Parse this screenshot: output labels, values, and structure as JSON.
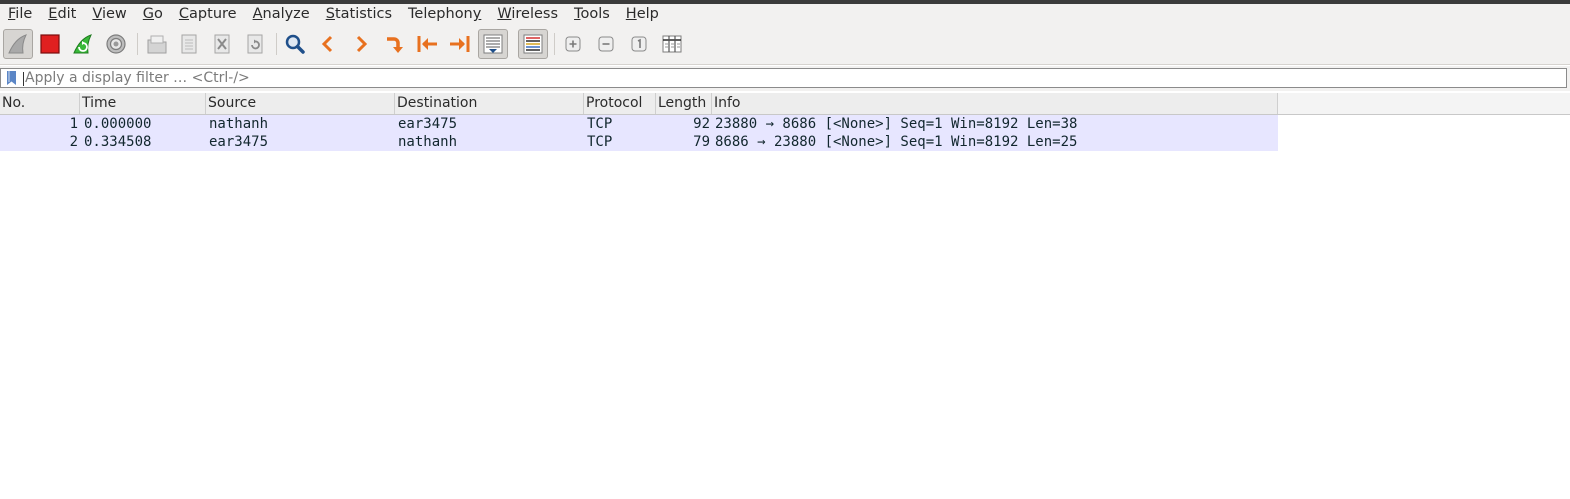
{
  "menu": [
    {
      "pre": "",
      "mn": "F",
      "post": "ile"
    },
    {
      "pre": "",
      "mn": "E",
      "post": "dit"
    },
    {
      "pre": "",
      "mn": "V",
      "post": "iew"
    },
    {
      "pre": "",
      "mn": "G",
      "post": "o"
    },
    {
      "pre": "",
      "mn": "C",
      "post": "apture"
    },
    {
      "pre": "",
      "mn": "A",
      "post": "nalyze"
    },
    {
      "pre": "",
      "mn": "S",
      "post": "tatistics"
    },
    {
      "pre": "Telephon",
      "mn": "y",
      "post": ""
    },
    {
      "pre": "",
      "mn": "W",
      "post": "ireless"
    },
    {
      "pre": "",
      "mn": "T",
      "post": "ools"
    },
    {
      "pre": "",
      "mn": "H",
      "post": "elp"
    }
  ],
  "toolbar": {
    "icons": [
      "start-capture-fin-icon",
      "stop-capture-icon",
      "restart-capture-icon",
      "capture-options-gear-icon",
      "open-file-icon",
      "save-file-icon",
      "close-file-icon",
      "reload-file-icon",
      "find-packet-icon",
      "go-back-icon",
      "go-forward-icon",
      "go-to-packet-icon",
      "first-packet-icon",
      "last-packet-icon",
      "auto-scroll-icon",
      "colorize-icon",
      "zoom-in-icon",
      "zoom-out-icon",
      "normal-size-icon",
      "resize-columns-icon"
    ]
  },
  "filter": {
    "placeholder": "Apply a display filter … <Ctrl-/>",
    "value": ""
  },
  "packet_list": {
    "columns": [
      "No.",
      "Time",
      "Source",
      "Destination",
      "Protocol",
      "Length",
      "Info"
    ],
    "rows": [
      {
        "no": "1",
        "time": "0.000000",
        "source": "nathanh",
        "destination": "ear3475",
        "protocol": "TCP",
        "length": "92",
        "info": "23880 → 8686 [<None>] Seq=1 Win=8192 Len=38"
      },
      {
        "no": "2",
        "time": "0.334508",
        "source": "ear3475",
        "destination": "nathanh",
        "protocol": "TCP",
        "length": "79",
        "info": "8686 → 23880 [<None>] Seq=1 Win=8192 Len=25"
      }
    ],
    "row_color": "#e7e6ff"
  },
  "colors": {
    "stop_red": "#e02020",
    "arrow_orange": "#e8711f",
    "find_blue": "#1f4f8a",
    "restart_green": "#2fa12f"
  }
}
